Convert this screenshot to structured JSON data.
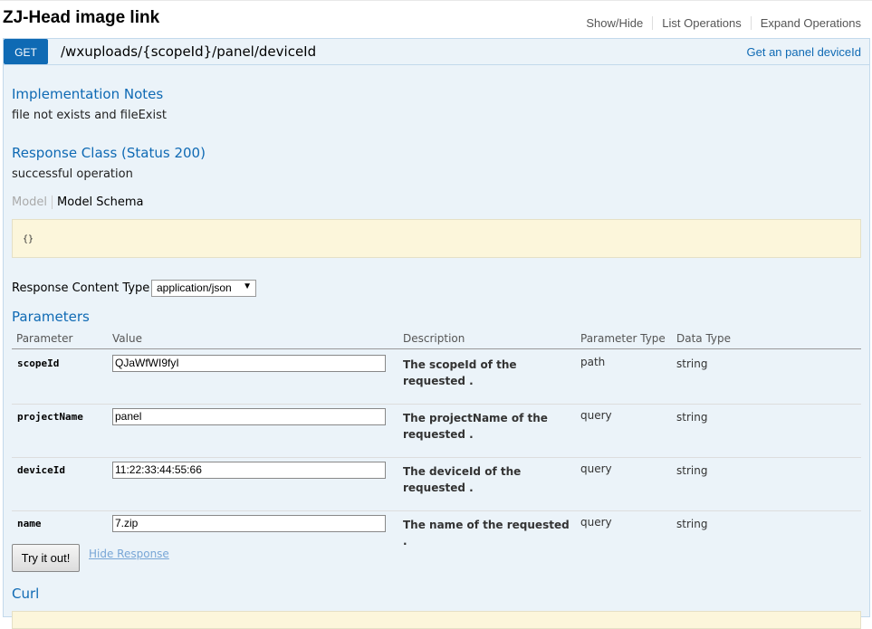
{
  "resource": {
    "title": "ZJ-Head image link",
    "links": [
      "Show/Hide",
      "List Operations",
      "Expand Operations"
    ]
  },
  "operation": {
    "method": "GET",
    "path": "/wxuploads/{scopeId}/panel/deviceId",
    "summary": "Get an panel deviceId"
  },
  "implementation_notes": {
    "heading": "Implementation Notes",
    "text": "file not exists and fileExist"
  },
  "response_class": {
    "heading": "Response Class (Status 200)",
    "text": "successful operation",
    "tabs": [
      "Model",
      "Model Schema"
    ],
    "schema": "{}"
  },
  "response_content_type": {
    "label": "Response Content Type",
    "selected": "application/json"
  },
  "parameters": {
    "heading": "Parameters",
    "columns": [
      "Parameter",
      "Value",
      "Description",
      "Parameter Type",
      "Data Type"
    ],
    "rows": [
      {
        "name": "scopeId",
        "value": "QJaWfWI9fyI",
        "description": "The scopeId of the requested .",
        "param_type": "path",
        "data_type": "string"
      },
      {
        "name": "projectName",
        "value": "panel",
        "description": "The projectName of the requested .",
        "param_type": "query",
        "data_type": "string"
      },
      {
        "name": "deviceId",
        "value": "11:22:33:44:55:66",
        "description": "The deviceId of the requested .",
        "param_type": "query",
        "data_type": "string"
      },
      {
        "name": "name",
        "value": "7.zip",
        "description": "The name of the requested .",
        "param_type": "query",
        "data_type": "string"
      }
    ]
  },
  "actions": {
    "try_label": "Try it out!",
    "hide_response_label": "Hide Response"
  },
  "curl": {
    "heading": "Curl"
  },
  "colors": {
    "get_badge": "#0f6ab4",
    "heading_blue": "#0f6ab4",
    "panel_bg": "#ebf3f9",
    "schema_bg": "#fcf6db"
  }
}
